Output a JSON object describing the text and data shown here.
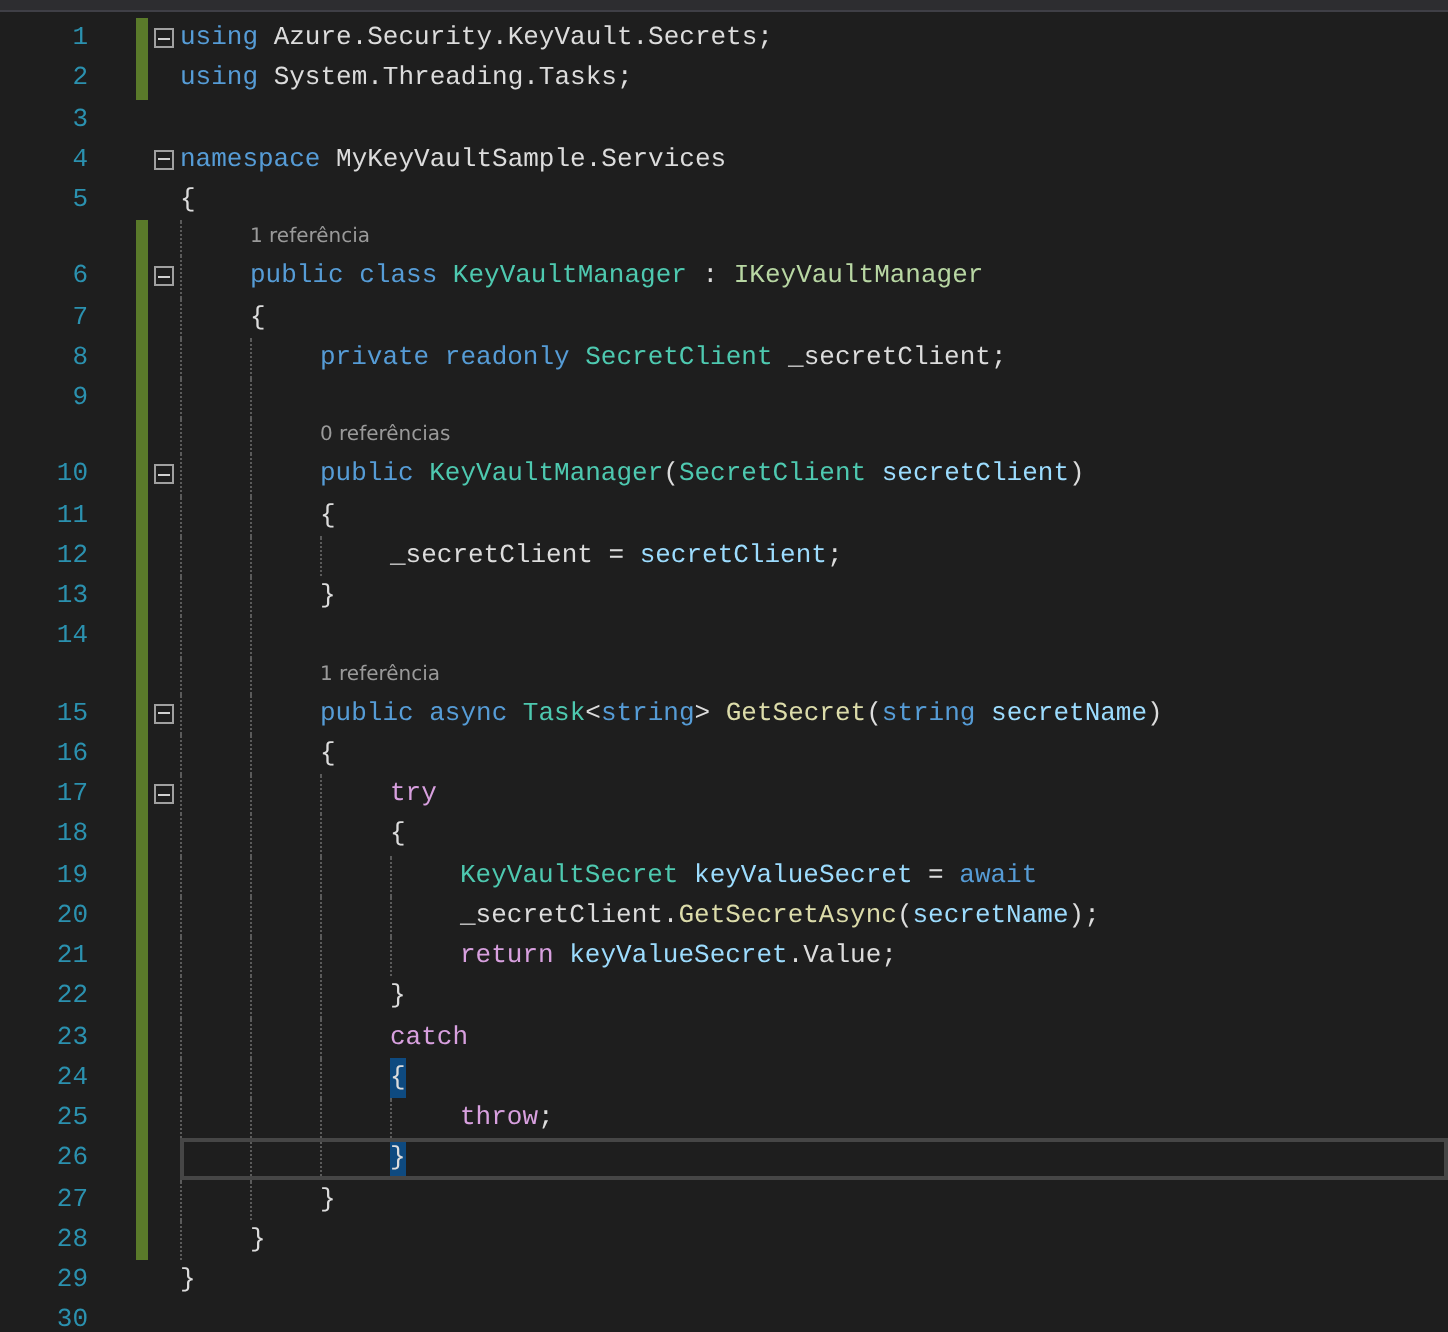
{
  "editor": {
    "lines": [
      {
        "kind": "code",
        "number": "1",
        "changed": true,
        "foldable": true,
        "current": false,
        "tokens": [
          {
            "text": "using ",
            "kind": "keyword"
          },
          {
            "text": "Azure.Security.KeyVault.Secrets;",
            "kind": "plain"
          }
        ]
      },
      {
        "kind": "code",
        "number": "2",
        "changed": true,
        "foldable": false,
        "current": false,
        "tokens": [
          {
            "text": "using ",
            "kind": "keyword"
          },
          {
            "text": "System.Threading.Tasks;",
            "kind": "plain"
          }
        ]
      },
      {
        "kind": "code",
        "number": "3",
        "changed": false,
        "foldable": false,
        "current": false
      },
      {
        "kind": "code",
        "number": "4",
        "changed": false,
        "foldable": true,
        "current": false,
        "tokens": [
          {
            "text": "namespace ",
            "kind": "keyword"
          },
          {
            "text": "MyKeyVaultSample.Services",
            "kind": "plain"
          }
        ]
      },
      {
        "kind": "code",
        "number": "5",
        "changed": false,
        "foldable": false,
        "current": false,
        "tokens": [
          {
            "text": "{",
            "kind": "plain"
          }
        ],
        "children": [
          {
            "kind": "codelens",
            "changed": true,
            "text": "1 referência"
          },
          {
            "kind": "code",
            "number": "6",
            "changed": true,
            "foldable": true,
            "current": false,
            "tokens": [
              {
                "text": "public class ",
                "kind": "keyword"
              },
              {
                "text": "KeyVaultManager",
                "kind": "type"
              },
              {
                "text": " : ",
                "kind": "plain"
              },
              {
                "text": "IKeyVaultManager",
                "kind": "interface"
              }
            ]
          },
          {
            "kind": "code",
            "number": "7",
            "changed": true,
            "foldable": false,
            "current": false,
            "tokens": [
              {
                "text": "{",
                "kind": "plain"
              }
            ],
            "children": [
              {
                "kind": "code",
                "number": "8",
                "changed": true,
                "foldable": false,
                "current": false,
                "tokens": [
                  {
                    "text": "private readonly ",
                    "kind": "keyword"
                  },
                  {
                    "text": "SecretClient ",
                    "kind": "type"
                  },
                  {
                    "text": "_secretClient;",
                    "kind": "plain"
                  }
                ]
              },
              {
                "kind": "code",
                "number": "9",
                "changed": true,
                "foldable": false,
                "current": false
              },
              {
                "kind": "codelens",
                "changed": true,
                "text": "0 referências"
              },
              {
                "kind": "code",
                "number": "10",
                "changed": true,
                "foldable": true,
                "current": false,
                "tokens": [
                  {
                    "text": "public ",
                    "kind": "keyword"
                  },
                  {
                    "text": "KeyVaultManager",
                    "kind": "type"
                  },
                  {
                    "text": "(",
                    "kind": "plain"
                  },
                  {
                    "text": "SecretClient ",
                    "kind": "type"
                  },
                  {
                    "text": "secretClient",
                    "kind": "variable"
                  },
                  {
                    "text": ")",
                    "kind": "plain"
                  }
                ]
              },
              {
                "kind": "code",
                "number": "11",
                "changed": true,
                "foldable": false,
                "current": false,
                "tokens": [
                  {
                    "text": "{",
                    "kind": "plain"
                  }
                ],
                "children": [
                  {
                    "kind": "code",
                    "number": "12",
                    "changed": true,
                    "foldable": false,
                    "current": false,
                    "tokens": [
                      {
                        "text": "_secretClient = ",
                        "kind": "plain"
                      },
                      {
                        "text": "secretClient",
                        "kind": "variable"
                      },
                      {
                        "text": ";",
                        "kind": "plain"
                      }
                    ]
                  }
                ]
              },
              {
                "kind": "code",
                "number": "13",
                "changed": true,
                "foldable": false,
                "current": false,
                "tokens": [
                  {
                    "text": "}",
                    "kind": "plain"
                  }
                ]
              },
              {
                "kind": "code",
                "number": "14",
                "changed": true,
                "foldable": false,
                "current": false
              },
              {
                "kind": "codelens",
                "changed": true,
                "text": "1 referência"
              },
              {
                "kind": "code",
                "number": "15",
                "changed": true,
                "foldable": true,
                "current": false,
                "tokens": [
                  {
                    "text": "public async ",
                    "kind": "keyword"
                  },
                  {
                    "text": "Task",
                    "kind": "type"
                  },
                  {
                    "text": "<",
                    "kind": "plain"
                  },
                  {
                    "text": "string",
                    "kind": "keyword"
                  },
                  {
                    "text": "> ",
                    "kind": "plain"
                  },
                  {
                    "text": "GetSecret",
                    "kind": "method"
                  },
                  {
                    "text": "(",
                    "kind": "plain"
                  },
                  {
                    "text": "string ",
                    "kind": "keyword"
                  },
                  {
                    "text": "secretName",
                    "kind": "variable"
                  },
                  {
                    "text": ")",
                    "kind": "plain"
                  }
                ]
              },
              {
                "kind": "code",
                "number": "16",
                "changed": true,
                "foldable": false,
                "current": false,
                "tokens": [
                  {
                    "text": "{",
                    "kind": "plain"
                  }
                ],
                "children": [
                  {
                    "kind": "code",
                    "number": "17",
                    "changed": true,
                    "foldable": true,
                    "current": false,
                    "tokens": [
                      {
                        "text": "try",
                        "kind": "control"
                      }
                    ]
                  },
                  {
                    "kind": "code",
                    "number": "18",
                    "changed": true,
                    "foldable": false,
                    "current": false,
                    "tokens": [
                      {
                        "text": "{",
                        "kind": "plain"
                      }
                    ],
                    "children": [
                      {
                        "kind": "code",
                        "number": "19",
                        "changed": true,
                        "foldable": false,
                        "current": false,
                        "tokens": [
                          {
                            "text": "KeyVaultSecret ",
                            "kind": "type"
                          },
                          {
                            "text": "keyValueSecret",
                            "kind": "variable"
                          },
                          {
                            "text": " = ",
                            "kind": "plain"
                          },
                          {
                            "text": "await",
                            "kind": "keyword"
                          }
                        ]
                      },
                      {
                        "kind": "code",
                        "number": "20",
                        "changed": true,
                        "foldable": false,
                        "current": false,
                        "tokens": [
                          {
                            "text": "_secretClient.",
                            "kind": "plain"
                          },
                          {
                            "text": "GetSecretAsync",
                            "kind": "method"
                          },
                          {
                            "text": "(",
                            "kind": "plain"
                          },
                          {
                            "text": "secretName",
                            "kind": "variable"
                          },
                          {
                            "text": ");",
                            "kind": "plain"
                          }
                        ]
                      },
                      {
                        "kind": "code",
                        "number": "21",
                        "changed": true,
                        "foldable": false,
                        "current": false,
                        "tokens": [
                          {
                            "text": "return ",
                            "kind": "control"
                          },
                          {
                            "text": "keyValueSecret",
                            "kind": "variable"
                          },
                          {
                            "text": ".Value;",
                            "kind": "plain"
                          }
                        ]
                      }
                    ]
                  },
                  {
                    "kind": "code",
                    "number": "22",
                    "changed": true,
                    "foldable": false,
                    "current": false,
                    "tokens": [
                      {
                        "text": "}",
                        "kind": "plain"
                      }
                    ]
                  },
                  {
                    "kind": "code",
                    "number": "23",
                    "changed": true,
                    "foldable": false,
                    "current": false,
                    "tokens": [
                      {
                        "text": "catch",
                        "kind": "control"
                      }
                    ]
                  },
                  {
                    "kind": "code",
                    "number": "24",
                    "changed": true,
                    "foldable": false,
                    "current": false,
                    "tokens": [
                      {
                        "text": "{",
                        "kind": "brace-match"
                      }
                    ],
                    "children": [
                      {
                        "kind": "code",
                        "number": "25",
                        "changed": true,
                        "foldable": false,
                        "current": false,
                        "tokens": [
                          {
                            "text": "throw",
                            "kind": "control"
                          },
                          {
                            "text": ";",
                            "kind": "plain"
                          }
                        ]
                      }
                    ]
                  },
                  {
                    "kind": "code",
                    "number": "26",
                    "changed": true,
                    "foldable": false,
                    "current": true,
                    "tokens": [
                      {
                        "text": "}",
                        "kind": "brace-match"
                      }
                    ]
                  }
                ]
              },
              {
                "kind": "code",
                "number": "27",
                "changed": true,
                "foldable": false,
                "current": false,
                "tokens": [
                  {
                    "text": "}",
                    "kind": "plain"
                  }
                ]
              }
            ]
          },
          {
            "kind": "code",
            "number": "28",
            "changed": true,
            "foldable": false,
            "current": false,
            "tokens": [
              {
                "text": "}",
                "kind": "plain"
              }
            ]
          }
        ]
      },
      {
        "kind": "code",
        "number": "29",
        "changed": false,
        "foldable": false,
        "current": false,
        "tokens": [
          {
            "text": "}",
            "kind": "plain"
          }
        ]
      },
      {
        "kind": "code",
        "number": "30",
        "changed": false,
        "foldable": false,
        "current": false
      }
    ]
  }
}
